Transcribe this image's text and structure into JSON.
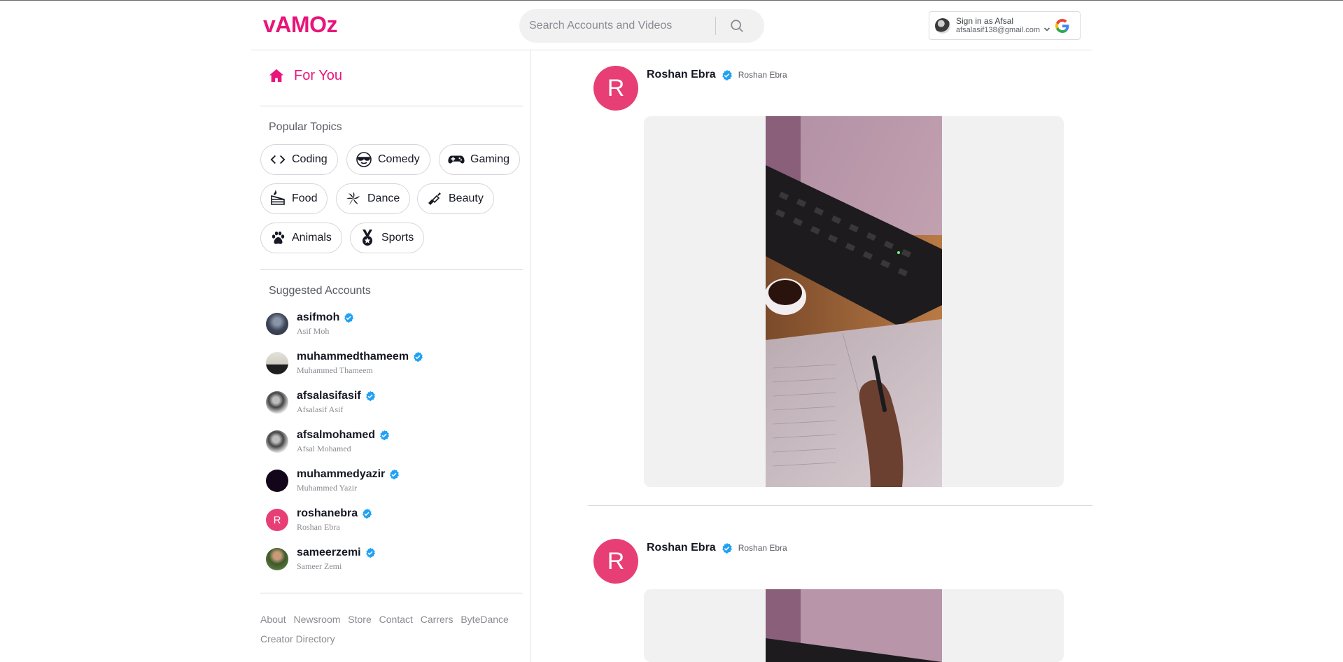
{
  "header": {
    "logo": "vAMOz",
    "search_placeholder": "Search Accounts and Videos",
    "signin": {
      "title": "Sign in as Afsal",
      "email": "afsalasif138@gmail.com"
    }
  },
  "sidebar": {
    "for_you_label": "For You",
    "popular_topics_title": "Popular Topics",
    "topics": [
      {
        "label": "Coding",
        "icon": "code-icon"
      },
      {
        "label": "Comedy",
        "icon": "sunglasses-face-icon"
      },
      {
        "label": "Gaming",
        "icon": "gamepad-icon"
      },
      {
        "label": "Food",
        "icon": "cake-icon"
      },
      {
        "label": "Dance",
        "icon": "disco-icon"
      },
      {
        "label": "Beauty",
        "icon": "lipstick-icon"
      },
      {
        "label": "Animals",
        "icon": "paw-icon"
      },
      {
        "label": "Sports",
        "icon": "medal-icon"
      }
    ],
    "suggested_title": "Suggested Accounts",
    "accounts": [
      {
        "username": "asifmoh",
        "name": "Asif Moh"
      },
      {
        "username": "muhammedthameem",
        "name": "Muhammed Thameem"
      },
      {
        "username": "afsalasifasif",
        "name": "Afsalasif Asif"
      },
      {
        "username": "afsalmohamed",
        "name": "Afsal Mohamed"
      },
      {
        "username": "muhammedyazir",
        "name": "Muhammed Yazir"
      },
      {
        "username": "roshanebra",
        "name": "Roshan Ebra",
        "initial": "R"
      },
      {
        "username": "sameerzemi",
        "name": "Sameer Zemi"
      }
    ],
    "footer_links": [
      "About",
      "Newsroom",
      "Store",
      "Contact",
      "Carrers",
      "ByteDance",
      "Creator Directory"
    ]
  },
  "feed": {
    "posts": [
      {
        "initial": "R",
        "username": "Roshan Ebra",
        "nickname": "Roshan Ebra"
      },
      {
        "initial": "R",
        "username": "Roshan Ebra",
        "nickname": "Roshan Ebra"
      }
    ]
  },
  "colors": {
    "brand": "#e8157a",
    "avatar_pink": "#e83e76",
    "verified_blue": "#20a1f3"
  }
}
